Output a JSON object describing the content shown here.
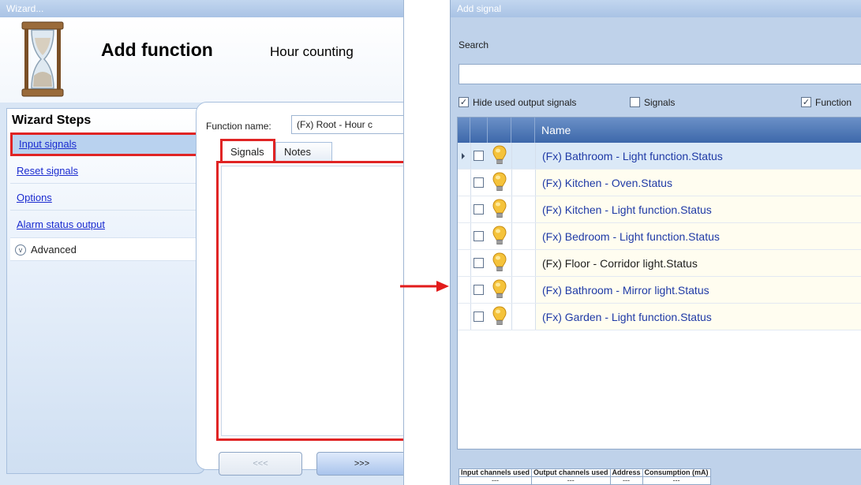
{
  "wizard": {
    "window_title": "Wizard...",
    "heading": "Add function",
    "subheading": "Hour counting",
    "steps_title": "Wizard Steps",
    "steps": [
      {
        "label": "Input signals",
        "selected": true
      },
      {
        "label": "Reset signals",
        "selected": false
      },
      {
        "label": "Options",
        "selected": false
      },
      {
        "label": "Alarm status output",
        "selected": false
      }
    ],
    "advanced_label": "Advanced",
    "function_name_label": "Function name:",
    "function_name_value": "(Fx) Root - Hour c",
    "tabs": [
      {
        "label": "Signals",
        "active": true
      },
      {
        "label": "Notes",
        "active": false
      }
    ],
    "prev_button": "<<<",
    "next_button": ">>>"
  },
  "add_signal": {
    "window_title": "Add signal",
    "search_label": "Search",
    "search_value": "",
    "filters": [
      {
        "label": "Hide used output signals",
        "checked": true
      },
      {
        "label": "Signals",
        "checked": false
      },
      {
        "label": "Function",
        "checked": true
      }
    ],
    "column_name": "Name",
    "rows": [
      {
        "name": "(Fx) Bathroom - Light function.Status",
        "icon": "bulb-icon",
        "checked": false,
        "current": true
      },
      {
        "name": "(Fx) Kitchen - Oven.Status",
        "icon": "bulb-icon",
        "checked": false,
        "current": false
      },
      {
        "name": "(Fx) Kitchen - Light function.Status",
        "icon": "bulb-icon",
        "checked": false,
        "current": false
      },
      {
        "name": "(Fx) Bedroom - Light function.Status",
        "icon": "bulb-icon",
        "checked": false,
        "current": false
      },
      {
        "name": "(Fx) Floor - Corridor light.Status",
        "icon": "dimmer-bulb-icon",
        "checked": false,
        "current": false
      },
      {
        "name": "(Fx) Bathroom - Mirror light.Status",
        "icon": "bulb-icon",
        "checked": false,
        "current": false
      },
      {
        "name": "(Fx) Garden - Light function.Status",
        "icon": "bulb-icon",
        "checked": false,
        "current": false
      }
    ],
    "stats_headers": [
      "Input channels used",
      "Output channels used",
      "Address",
      "Consumption (mA)"
    ],
    "stats_values": [
      "---",
      "---",
      "---",
      "---"
    ]
  },
  "colors": {
    "highlight_red": "#e02424",
    "link_blue": "#1a2bd0",
    "header_blue": "#3d68aa"
  }
}
